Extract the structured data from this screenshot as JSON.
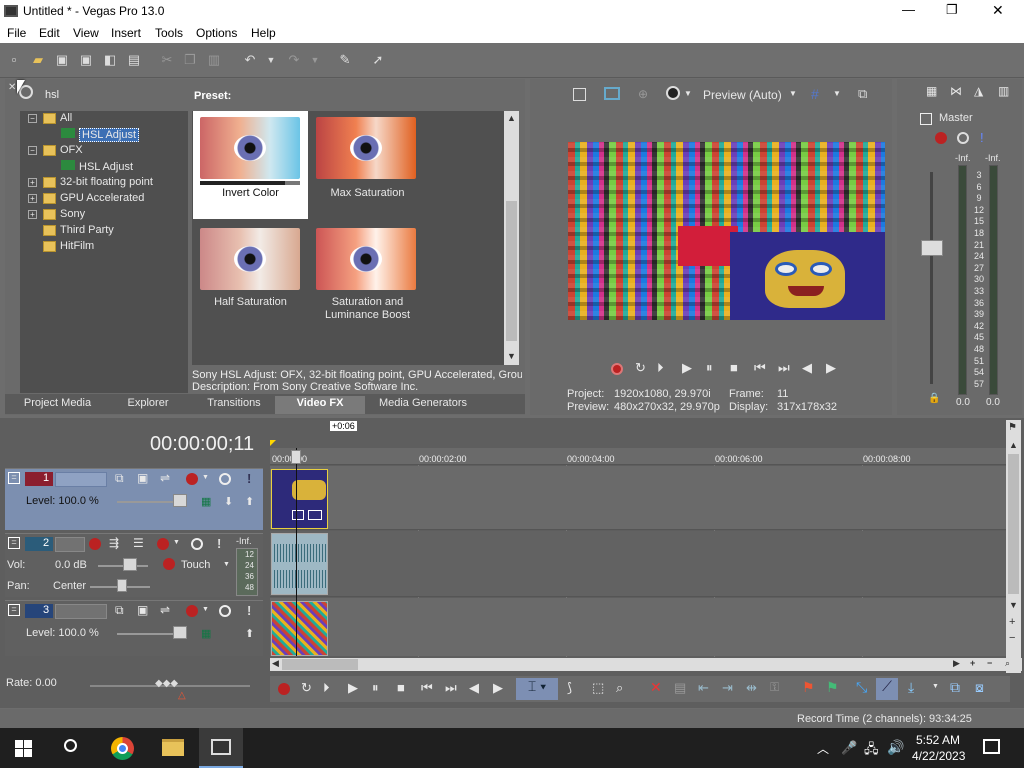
{
  "window": {
    "title": "Untitled * - Vegas Pro 13.0",
    "min": "—",
    "max": "❐",
    "close": "✕"
  },
  "menu": [
    "File",
    "Edit",
    "View",
    "Insert",
    "Tools",
    "Options",
    "Help"
  ],
  "fx_browser": {
    "search_value": "hsl",
    "preset_label": "Preset:",
    "tree": [
      {
        "label": "All",
        "level": 0
      },
      {
        "label": "HSL Adjust",
        "level": 1,
        "selected": true
      },
      {
        "label": "OFX",
        "level": 0
      },
      {
        "label": "HSL Adjust",
        "level": 1
      },
      {
        "label": "32-bit floating point",
        "level": 0
      },
      {
        "label": "GPU Accelerated",
        "level": 0
      },
      {
        "label": "Sony",
        "level": 0
      },
      {
        "label": "Third Party",
        "level": 0
      },
      {
        "label": "HitFilm",
        "level": 0
      }
    ],
    "presets": [
      "Invert Color",
      "Max Saturation",
      "Half Saturation",
      "Saturation and Luminance Boost"
    ],
    "description1": "Sony HSL Adjust: OFX, 32-bit floating point, GPU Accelerated, Grou",
    "description2": "Description: From Sony Creative Software Inc.",
    "tabs": [
      "Project Media",
      "Explorer",
      "Transitions",
      "Video FX",
      "Media Generators"
    ],
    "active_tab": "Video FX"
  },
  "preview": {
    "mode": "Preview (Auto)",
    "project_label": "Project:",
    "project_value": "1920x1080, 29.970i",
    "frame_label": "Frame:",
    "frame_value": "11",
    "preview_label": "Preview:",
    "preview_value": "480x270x32, 29.970p",
    "display_label": "Display:",
    "display_value": "317x178x32"
  },
  "master": {
    "label": "Master",
    "inf_left": "-Inf.",
    "inf_right": "-Inf.",
    "scale": [
      "3",
      "6",
      "9",
      "12",
      "15",
      "18",
      "21",
      "24",
      "27",
      "30",
      "33",
      "36",
      "39",
      "42",
      "45",
      "48",
      "51",
      "54",
      "57"
    ],
    "bottom_left": "0.0",
    "bottom_right": "0.0"
  },
  "timeline": {
    "timecode": "00:00:00;11",
    "offset_badge": "+0:06",
    "ruler": [
      "00:00:00",
      "00:00:02:00",
      "00:00:04:00",
      "00:00:06:00",
      "00:00:08:00"
    ],
    "tracks": [
      {
        "num": "1",
        "level_label": "Level: 100.0 %"
      },
      {
        "num": "2",
        "vol_label": "Vol:",
        "vol_value": "0.0 dB",
        "pan_label": "Pan:",
        "pan_value": "Center",
        "mode": "Touch",
        "meter_top": "-Inf.",
        "meter_vals": [
          "12",
          "24",
          "36",
          "48"
        ]
      },
      {
        "num": "3",
        "level_label": "Level: 100.0 %"
      }
    ],
    "rate": "Rate: 0.00",
    "record_time": "Record Time (2 channels): 93:34:25"
  },
  "taskbar": {
    "time": "5:52 AM",
    "date": "4/22/2023"
  }
}
